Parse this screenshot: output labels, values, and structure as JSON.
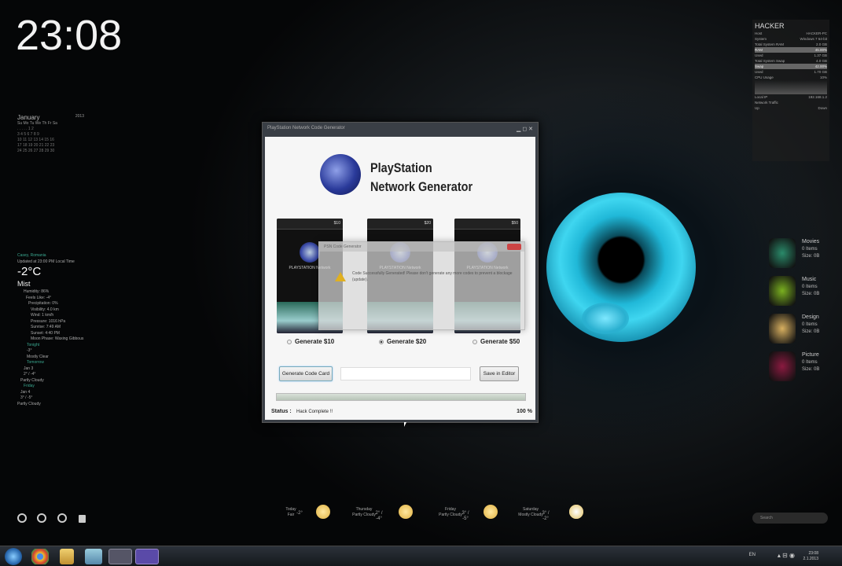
{
  "desktop": {
    "clock": "23:08"
  },
  "calendar": {
    "month": "January",
    "year": "2013",
    "weekdays": "Su Mo Tu We Th Fr Sa"
  },
  "weather": {
    "location": "Casey, Romania",
    "updated": "Updated at 23:00 PM Local Time",
    "temp": "-2°C",
    "condition": "Mist",
    "details": [
      "Humidity: 86%",
      "Feels Like: -4°",
      "Precipitation: 0%",
      "Visibility: 4.0 km",
      "Wind: 1 km/h",
      "Pressure: 1016 hPa",
      "Sunrise: 7:49 AM",
      "Sunset: 4:40 PM",
      "Moon Phase: Waxing Gibbous"
    ],
    "tonight_label": "Tonight",
    "tonight_temp": "-3°",
    "tonight_cond": "Mostly Clear",
    "d1_label": "Tomorrow",
    "d1_day": "Jan 3",
    "d1_temp": "2° / -4°",
    "d1_cond": "Partly Cloudy",
    "d2_label": "Friday",
    "d2_day": "Jan 4",
    "d2_temp": "3° / -5°",
    "d2_cond": "Partly Cloudy"
  },
  "sysmon": {
    "title": "HACKER",
    "rows": [
      [
        "Host",
        "HACKER-PC"
      ],
      [
        "System",
        "Windows 7 64-bit"
      ],
      [
        "Total System RAM",
        "2.0 GB"
      ],
      [
        "RAM",
        "45.00%"
      ],
      [
        "Used",
        "1.37 GB"
      ],
      [
        "Total System Swap",
        "4.0 GB"
      ],
      [
        "Swap",
        "42.00%"
      ],
      [
        "Used",
        "1.70 GB"
      ],
      [
        "CPU Usage",
        "10%"
      ],
      [
        "Local IP",
        "192.168.1.2"
      ],
      [
        "Network Traffic",
        ""
      ],
      [
        "Up",
        "Down"
      ]
    ]
  },
  "library": [
    {
      "label": "Movies",
      "items": "0 Items",
      "size": "Size: 0B",
      "color": "#2a8a6a"
    },
    {
      "label": "Music",
      "items": "0 Items",
      "size": "Size: 0B",
      "color": "#7ab020"
    },
    {
      "label": "Design",
      "items": "0 Items",
      "size": "Size: 0B",
      "color": "#d8b060"
    },
    {
      "label": "Picture",
      "items": "0 Items",
      "size": "Size: 0B",
      "color": "#8a1a40"
    }
  ],
  "app": {
    "window_title": "PlayStation Network Code Generator",
    "title_line1": "PlayStation",
    "title_line2": "Network Generator",
    "cards": [
      {
        "value": "$10",
        "brand": "PLAYSTATION Network"
      },
      {
        "value": "$20",
        "brand": "PLAYSTATION Network"
      },
      {
        "value": "$50",
        "brand": "PLAYSTATION Network"
      }
    ],
    "options": [
      {
        "label": "Generate $10",
        "selected": false
      },
      {
        "label": "Generate $20",
        "selected": true
      },
      {
        "label": "Generate $50",
        "selected": false
      }
    ],
    "generate_button": "Generate Code Card",
    "save_button": "Save in Editor",
    "code_value": "",
    "progress_percent": 100,
    "status_label": "Status :",
    "status_value": "Hack Complete !!",
    "progress_text": "100 %"
  },
  "dialog": {
    "title": "PSN Code Generator",
    "message": "Code Successfully Generated! Please don't generate any more codes to prevent a blockage (update)."
  },
  "forecast": [
    {
      "day": "Today",
      "cond": "Fair",
      "temp": "-2°"
    },
    {
      "day": "Thursday",
      "cond": "Partly Cloudy",
      "temp": "2° / -4°"
    },
    {
      "day": "Friday",
      "cond": "Partly Cloudy",
      "temp": "3° / -5°"
    },
    {
      "day": "Saturday",
      "cond": "Mostly Cloudy",
      "temp": "3° / -2°"
    }
  ],
  "search": {
    "placeholder": "Search"
  },
  "taskbar": {
    "lang": "EN",
    "time": "23:08",
    "date": "2.1.2013"
  },
  "colors": {
    "accent": "#3fd6f0",
    "window": "#f6f6f6"
  }
}
